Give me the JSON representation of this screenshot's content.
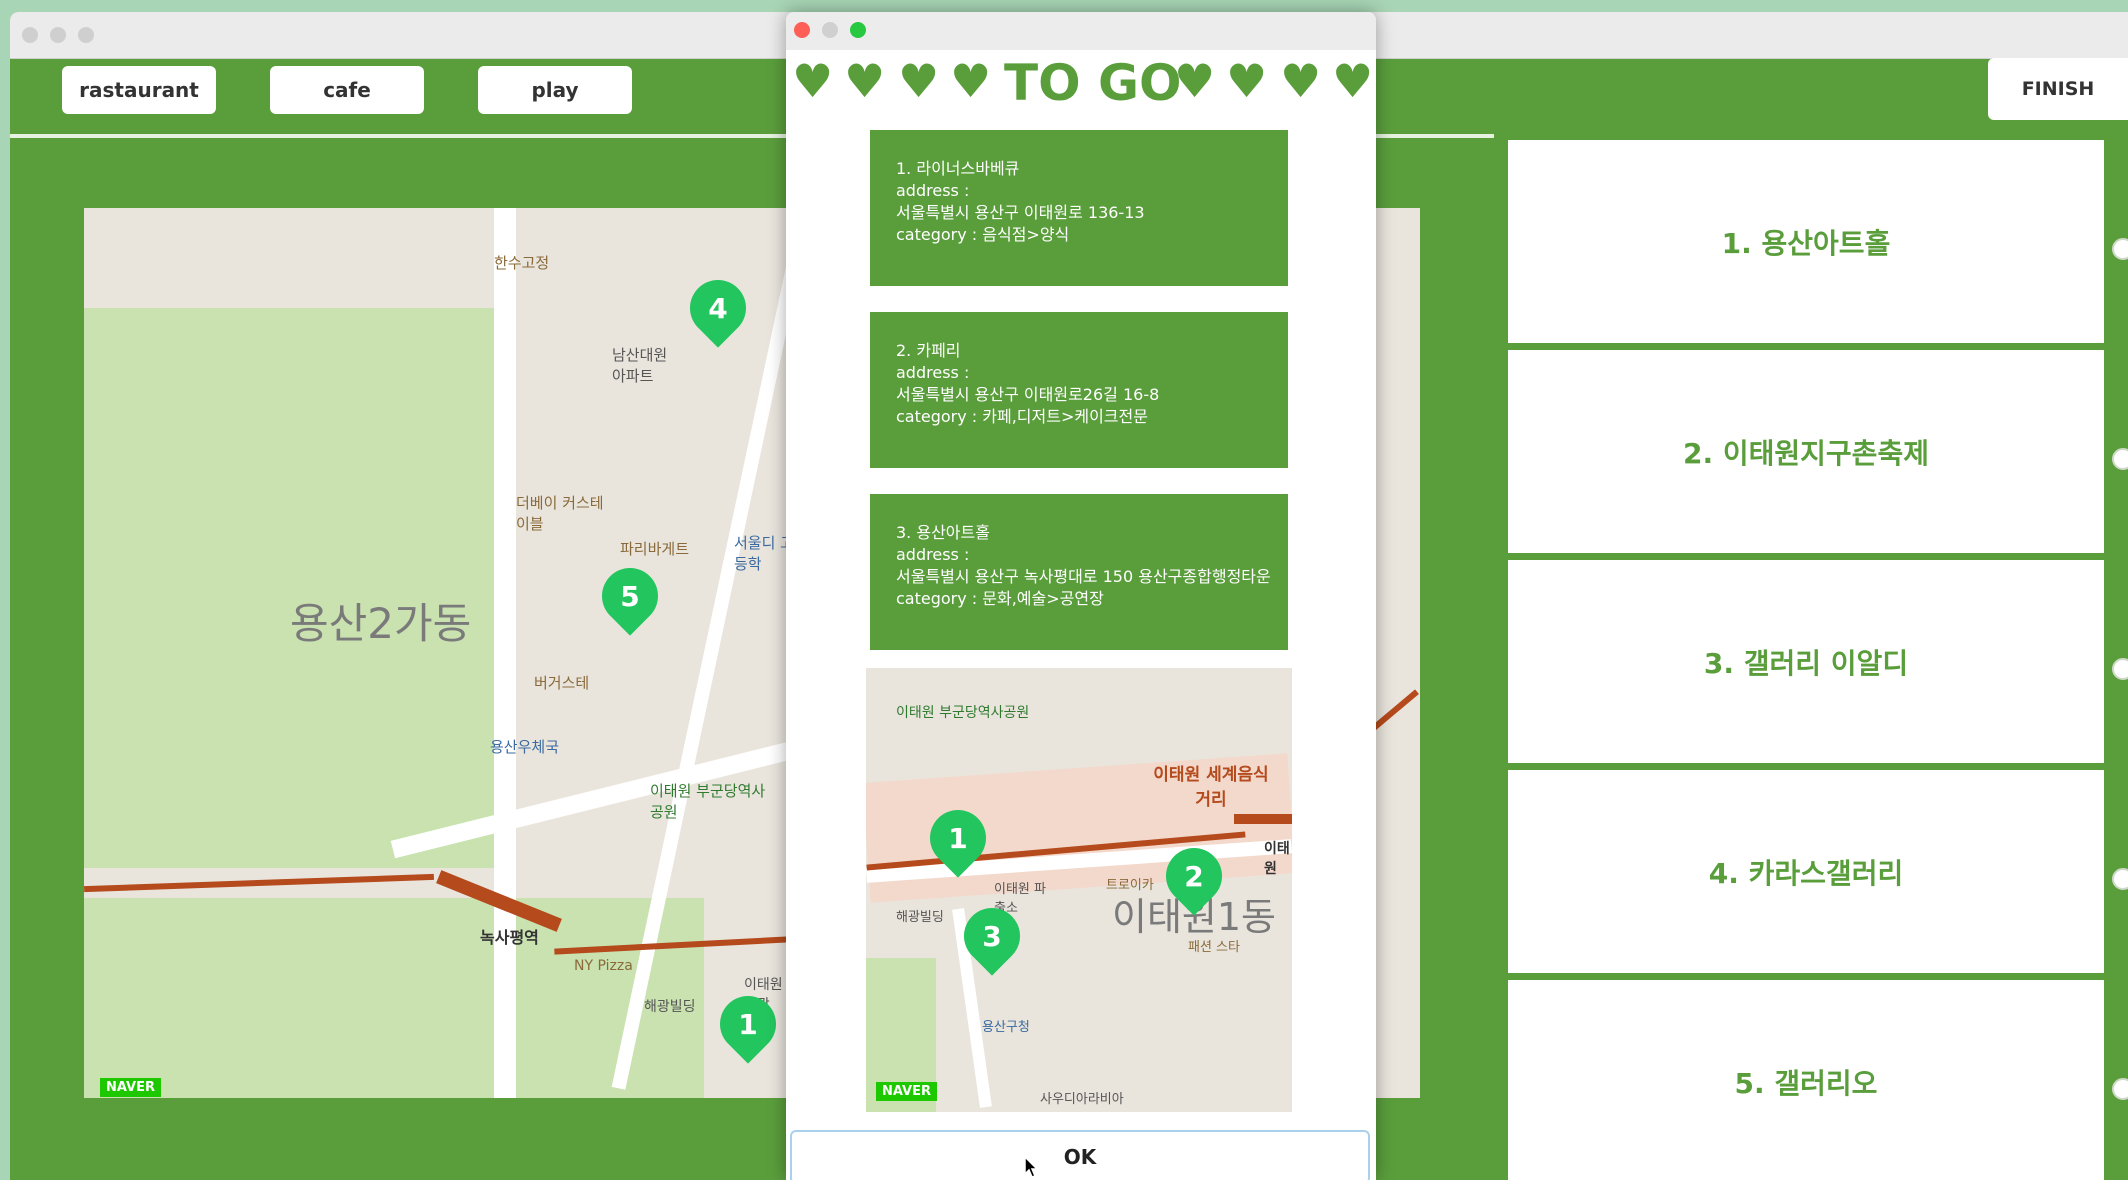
{
  "toolbar": {
    "categories": [
      "rastaurant",
      "cafe",
      "play"
    ],
    "finish_label": "FINISH"
  },
  "main_map": {
    "area_label": "용산2가동",
    "pins": [
      "1",
      "4",
      "5"
    ],
    "labels": [
      "한수고정",
      "남산대원 아파트",
      "더베이 커스테이블",
      "파리바게트",
      "서울디 고등학",
      "용산우체국",
      "이태원 부군당역사공원",
      "녹사평역",
      "NY Pizza",
      "해광빌딩",
      "이태원 해광",
      "버거스테"
    ],
    "brand": "NAVER"
  },
  "dialog": {
    "title": "TO GO",
    "heart": "♥",
    "items": [
      {
        "name": "1. 라이너스바베큐",
        "address_label": "address :",
        "address": "서울특별시 용산구 이태원로 136-13",
        "category": "category : 음식점>양식"
      },
      {
        "name": "2. 카페리",
        "address_label": "address :",
        "address": "서울특별시 용산구 이태원로26길 16-8",
        "category": "category : 카페,디저트>케이크전문"
      },
      {
        "name": "3. 용산아트홀",
        "address_label": "address :",
        "address": "서울특별시 용산구 녹사평대로 150 용산구종합행정타운",
        "category": "category : 문화,예술>공연장"
      }
    ],
    "map": {
      "pins": [
        "1",
        "2",
        "3"
      ],
      "area_label": "이태원1동",
      "labels": [
        "이태원 부군당역사공원",
        "이태원 세계음식거리",
        "이태원",
        "트로이카",
        "이태원 파출소",
        "해광빌딩",
        "용산구청",
        "패션 스타",
        "사우디아라비아"
      ],
      "brand": "NAVER"
    },
    "ok_label": "OK"
  },
  "sidebar": {
    "items": [
      "1. 용산아트홀",
      "2. 이태원지구촌축제",
      "3. 갤러리 이알디",
      "4. 카라스갤러리",
      "5. 갤러리오"
    ]
  },
  "colors": {
    "accent": "#5a9e3c",
    "pin": "#22c55e",
    "route": "#b54a1c"
  }
}
